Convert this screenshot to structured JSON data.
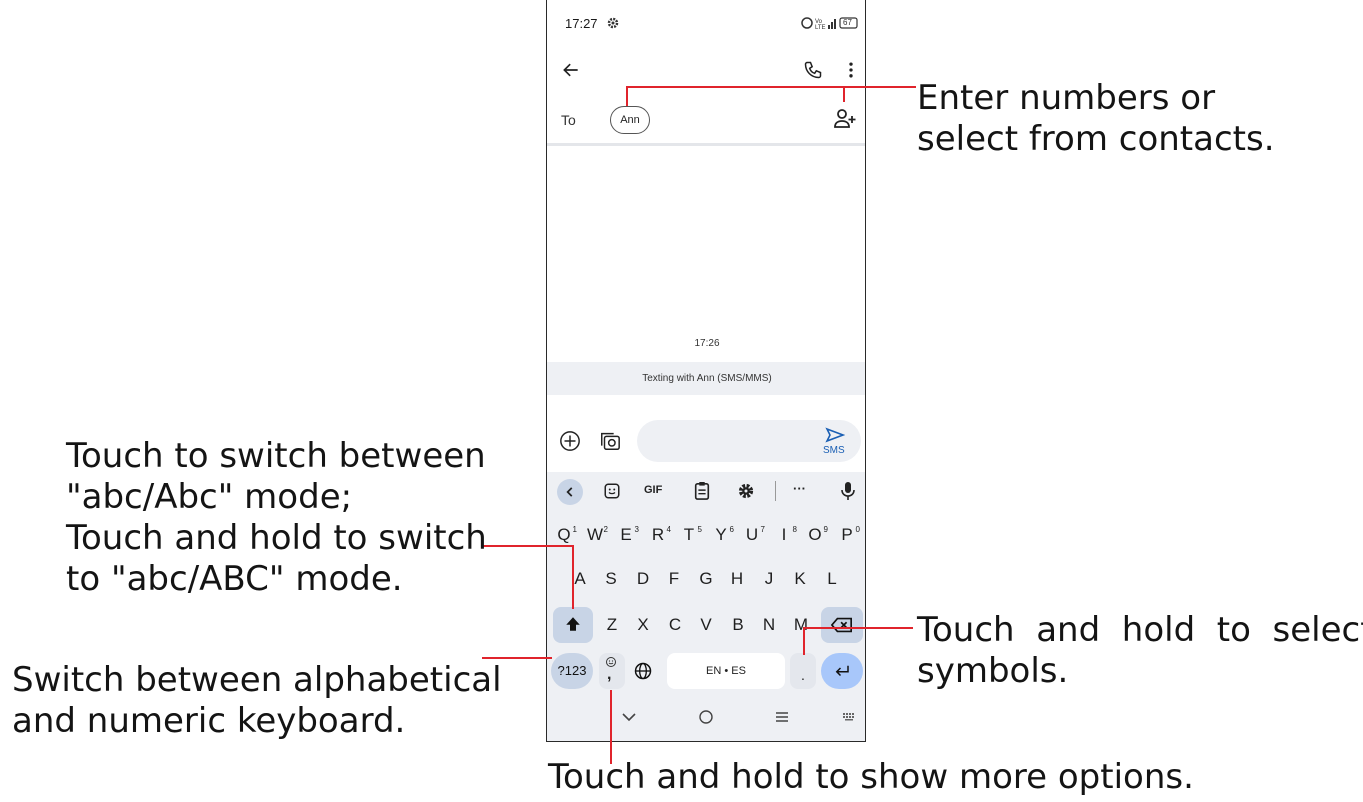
{
  "status_bar": {
    "time": "17:27",
    "battery": "67"
  },
  "recipient": {
    "to_label": "To",
    "chip_name": "Ann"
  },
  "conversation": {
    "timestamp": "17:26",
    "info": "Texting with Ann (SMS/MMS)"
  },
  "compose": {
    "send_label": "SMS"
  },
  "keyboard": {
    "toolbar": {
      "gif_label": "GIF",
      "more_label": "···"
    },
    "row1": [
      {
        "key": "Q",
        "hint": "1"
      },
      {
        "key": "W",
        "hint": "2"
      },
      {
        "key": "E",
        "hint": "3"
      },
      {
        "key": "R",
        "hint": "4"
      },
      {
        "key": "T",
        "hint": "5"
      },
      {
        "key": "Y",
        "hint": "6"
      },
      {
        "key": "U",
        "hint": "7"
      },
      {
        "key": "I",
        "hint": "8"
      },
      {
        "key": "O",
        "hint": "9"
      },
      {
        "key": "P",
        "hint": "0"
      }
    ],
    "row2": [
      "A",
      "S",
      "D",
      "F",
      "G",
      "H",
      "J",
      "K",
      "L"
    ],
    "row3": [
      "Z",
      "X",
      "C",
      "V",
      "B",
      "N",
      "M"
    ],
    "symbols_key": "?123",
    "comma_key": ",",
    "space_label": "EN • ES",
    "period_key": "."
  },
  "callouts": {
    "contacts": [
      "Enter numbers or",
      "select from contacts."
    ],
    "shift": [
      "Touch to switch between",
      "\"abc/Abc\" mode;",
      "Touch and hold to switch",
      "to \"abc/ABC\" mode."
    ],
    "numeric": [
      "Switch between alphabetical",
      "and numeric keyboard."
    ],
    "symbols": [
      "Touch  and  hold  to  select",
      "symbols."
    ],
    "more_options": "Touch and hold to show more options."
  },
  "colors": {
    "accent": "#1a73e8",
    "callout_line": "#e0242c",
    "keyboard_bg": "#eef0f4",
    "key_special": "#c8d4e6"
  }
}
